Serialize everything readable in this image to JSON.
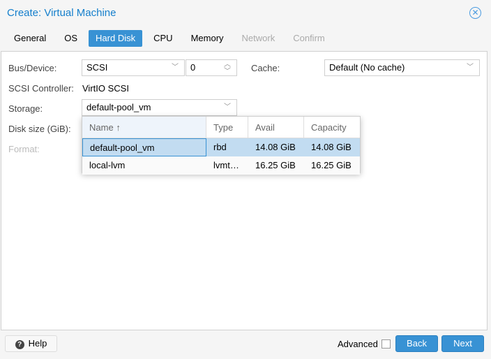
{
  "window": {
    "title": "Create: Virtual Machine"
  },
  "tabs": [
    {
      "label": "General"
    },
    {
      "label": "OS"
    },
    {
      "label": "Hard Disk"
    },
    {
      "label": "CPU"
    },
    {
      "label": "Memory"
    },
    {
      "label": "Network"
    },
    {
      "label": "Confirm"
    }
  ],
  "form": {
    "bus_label": "Bus/Device:",
    "bus_value": "SCSI",
    "device_value": "0",
    "cache_label": "Cache:",
    "cache_value": "Default (No cache)",
    "controller_label": "SCSI Controller:",
    "controller_value": "VirtIO SCSI",
    "storage_label": "Storage:",
    "storage_value": "default-pool_vm",
    "disk_size_label": "Disk size (GiB):",
    "format_label": "Format:"
  },
  "storage_list": {
    "columns": [
      "Name",
      "Type",
      "Avail",
      "Capacity"
    ],
    "sort_icon": "↑",
    "rows": [
      {
        "name": "default-pool_vm",
        "type": "rbd",
        "avail": "14.08 GiB",
        "capacity": "14.08 GiB",
        "selected": true
      },
      {
        "name": "local-lvm",
        "type": "lvmt…",
        "avail": "16.25 GiB",
        "capacity": "16.25 GiB",
        "selected": false
      }
    ]
  },
  "footer": {
    "help": "Help",
    "advanced": "Advanced",
    "back": "Back",
    "next": "Next"
  },
  "colors": {
    "accent": "#3892d4",
    "selected_row": "#c2dcf1"
  }
}
